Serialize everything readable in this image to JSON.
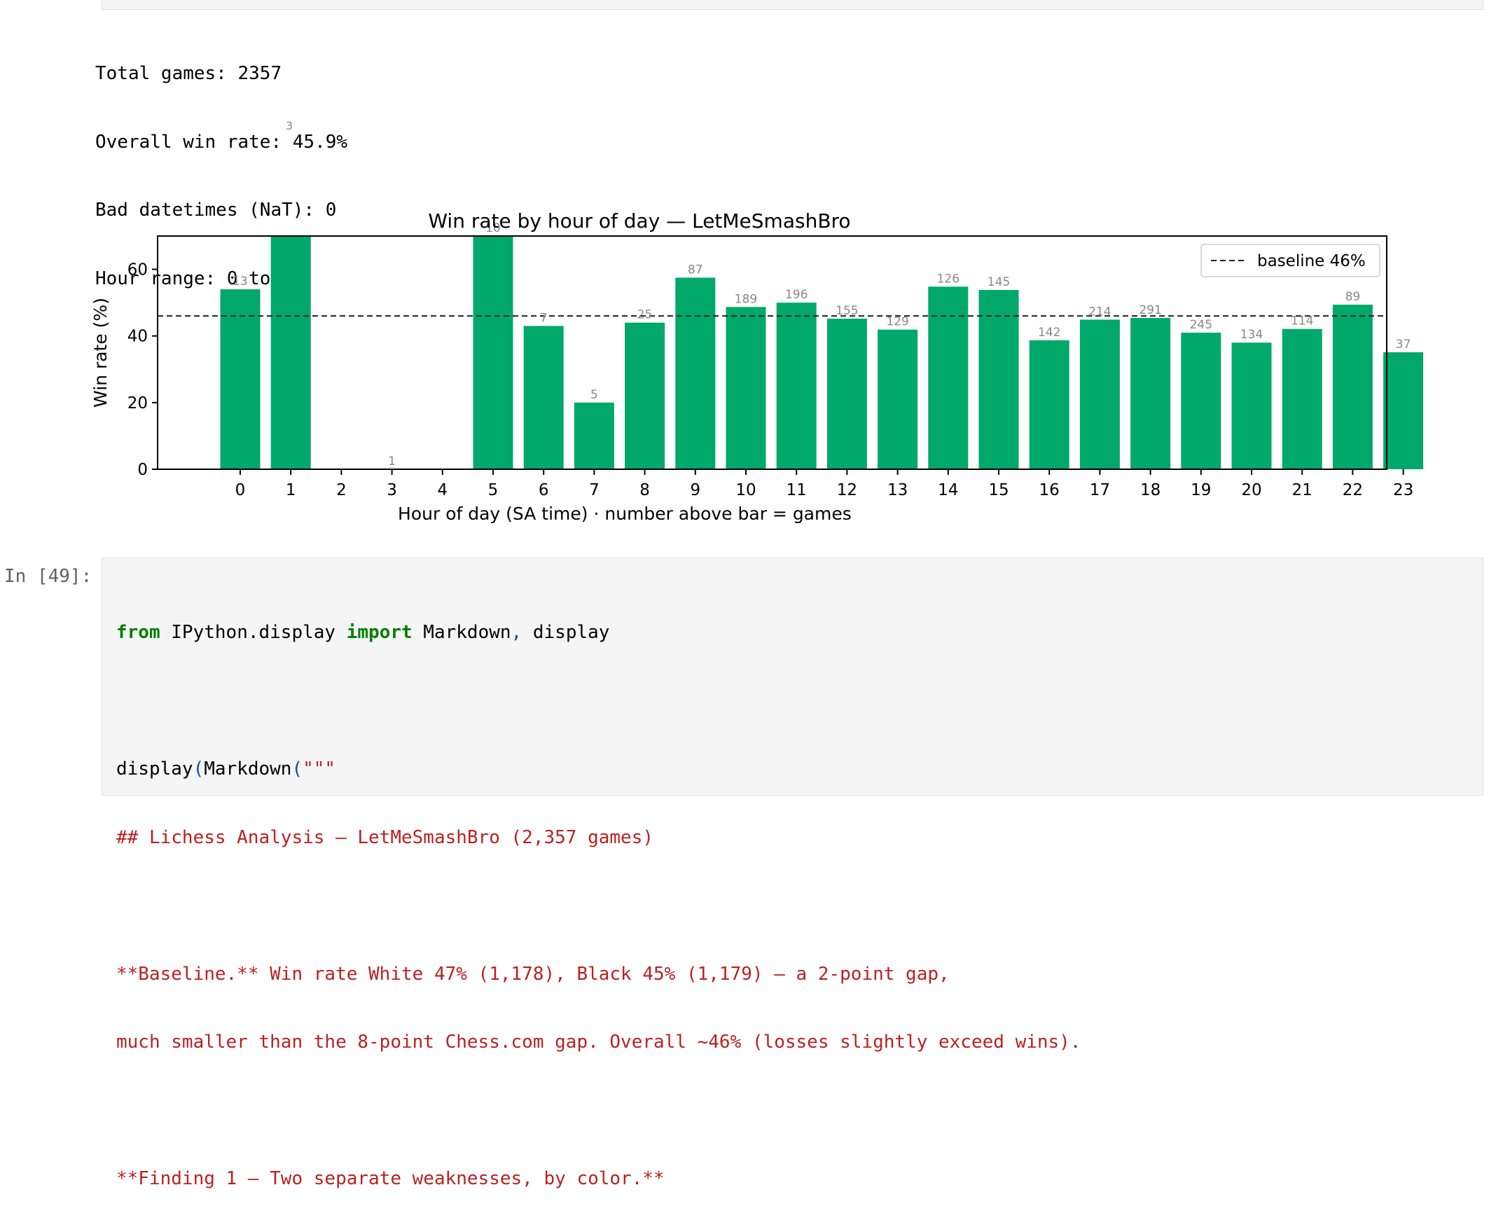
{
  "output": {
    "lines": [
      "Total games: 2357",
      "Overall win rate: 45.9%",
      "Bad datetimes (NaT): 0",
      "Hour range: 0 to 23"
    ],
    "stray_label": "3"
  },
  "chart_data": {
    "type": "bar",
    "title": "Win rate by hour of day — LetMeSmashBro",
    "xlabel": "Hour of day (SA time)  ·  number above bar = games",
    "ylabel": "Win rate (%)",
    "ylim": [
      0,
      70
    ],
    "yticks": [
      0,
      20,
      40,
      60
    ],
    "categories": [
      "0",
      "1",
      "2",
      "3",
      "4",
      "5",
      "6",
      "7",
      "8",
      "9",
      "10",
      "11",
      "12",
      "13",
      "14",
      "15",
      "16",
      "17",
      "18",
      "19",
      "20",
      "21",
      "22",
      "23"
    ],
    "values": [
      54,
      70,
      0,
      0,
      0,
      70,
      43,
      20,
      44,
      57.5,
      48.7,
      50,
      45.2,
      41.9,
      54.8,
      53.8,
      38.7,
      44.9,
      45.4,
      41,
      38,
      42.1,
      49.4,
      35.1
    ],
    "games": [
      13,
      null,
      null,
      1,
      null,
      10,
      7,
      5,
      25,
      87,
      189,
      196,
      155,
      129,
      126,
      145,
      142,
      214,
      291,
      245,
      134,
      114,
      89,
      37
    ],
    "baseline": 46,
    "legend": {
      "label": "baseline 46%",
      "position": "top-right"
    },
    "bar_color": "#00a86b",
    "grid": false
  },
  "code_cell": {
    "prompt": "In [49]:",
    "line1": {
      "kw1": "from",
      "mod": " IPython.display ",
      "kw2": "import",
      "names": " Markdown",
      "comma": ",",
      "rest": " display"
    },
    "line2": "",
    "line3": {
      "a": "display",
      "p1": "(",
      "b": "Markdown",
      "p2": "(",
      "s": "\"\"\""
    },
    "lines_str": [
      "## Lichess Analysis — LetMeSmashBro (2,357 games)",
      "",
      "**Baseline.** Win rate White 47% (1,178), Black 45% (1,179) — a 2-point gap,",
      "much smaller than the 8-point Chess.com gap. Overall ~46% (losses slightly exceed wins).",
      "",
      "**Finding 1 — Two separate weaknesses, by color.**"
    ]
  }
}
